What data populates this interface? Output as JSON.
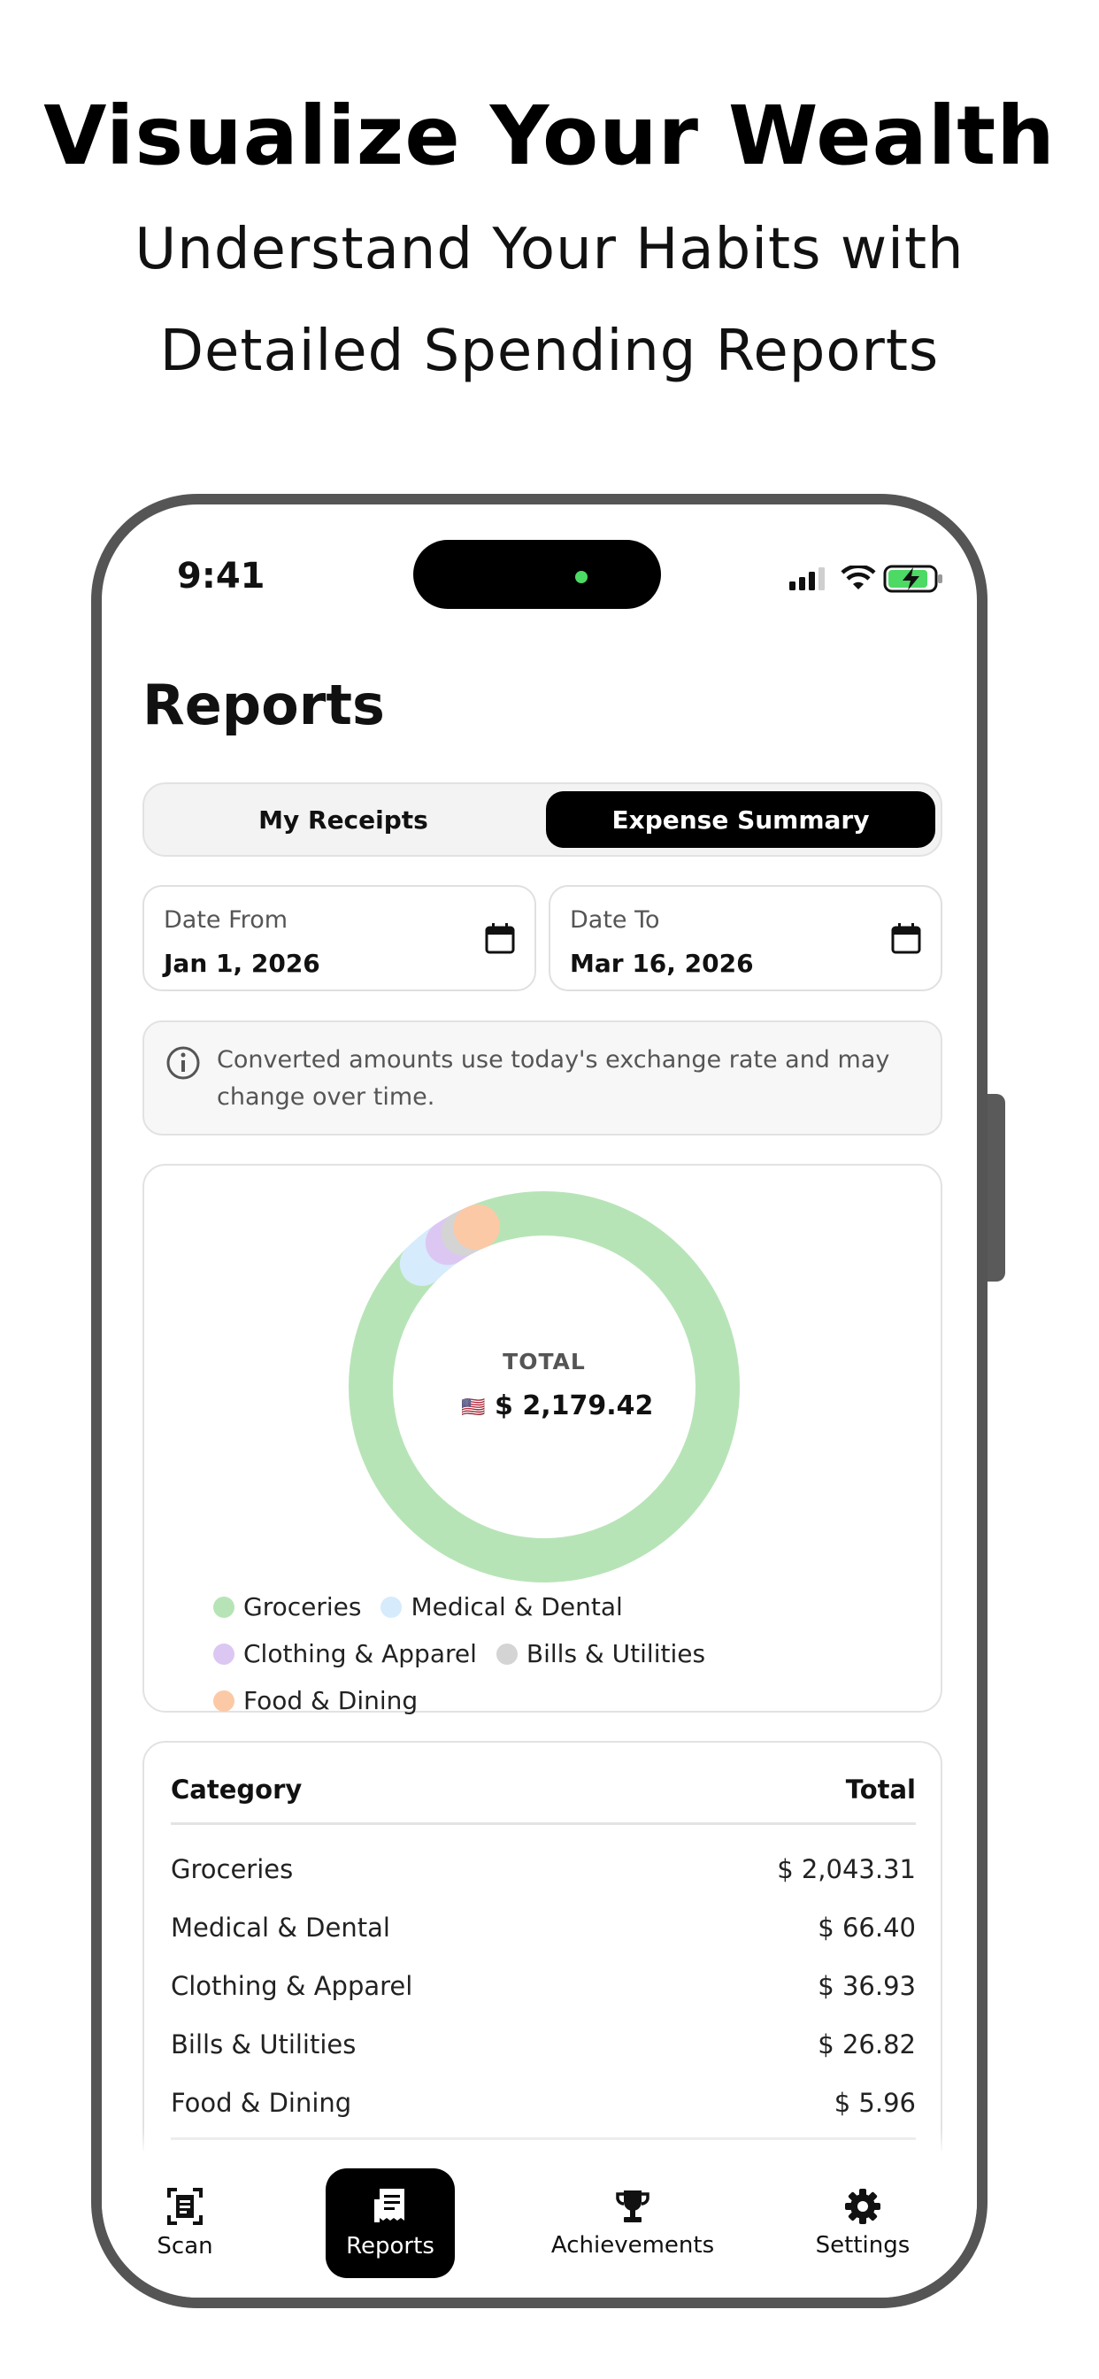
{
  "promo": {
    "headline": "Visualize Your Wealth",
    "subline_1": "Understand Your Habits with",
    "subline_2": "Detailed Spending Reports"
  },
  "status_bar": {
    "time": "9:41"
  },
  "page": {
    "title": "Reports"
  },
  "segment": {
    "left_label": "My Receipts",
    "right_label": "Expense Summary",
    "selected": "Expense Summary"
  },
  "date_from": {
    "label": "Date From",
    "value": "Jan 1, 2026"
  },
  "date_to": {
    "label": "Date To",
    "value": "Mar 16, 2026"
  },
  "info": {
    "text": "Converted amounts use today's exchange rate and may change over time."
  },
  "donut": {
    "center_label": "TOTAL",
    "flag": "🇺🇸",
    "total": "$ 2,179.42"
  },
  "chart_data": {
    "type": "pie",
    "categories": [
      "Groceries",
      "Medical & Dental",
      "Clothing & Apparel",
      "Bills & Utilities",
      "Food & Dining"
    ],
    "values": [
      2043.31,
      66.4,
      36.93,
      26.82,
      5.96
    ],
    "colors": [
      "#b7e4b7",
      "#d6ebfb",
      "#dcc7f3",
      "#d4d4d4",
      "#fcc9a6"
    ]
  },
  "legend": [
    {
      "label": "Groceries",
      "color": "#b7e4b7"
    },
    {
      "label": "Medical & Dental",
      "color": "#d6ebfb"
    },
    {
      "label": "Clothing & Apparel",
      "color": "#dcc7f3"
    },
    {
      "label": "Bills & Utilities",
      "color": "#d4d4d4"
    },
    {
      "label": "Food & Dining",
      "color": "#fcc9a6"
    }
  ],
  "table": {
    "col_category": "Category",
    "col_total": "Total",
    "rows": [
      {
        "category": "Groceries",
        "total": "$ 2,043.31"
      },
      {
        "category": "Medical & Dental",
        "total": "$ 66.40"
      },
      {
        "category": "Clothing & Apparel",
        "total": "$ 36.93"
      },
      {
        "category": "Bills & Utilities",
        "total": "$ 26.82"
      },
      {
        "category": "Food & Dining",
        "total": "$ 5.96"
      }
    ]
  },
  "tabbar": {
    "items": [
      {
        "label": "Scan",
        "icon": "scan-icon"
      },
      {
        "label": "Reports",
        "icon": "receipt-icon",
        "active": true
      },
      {
        "label": "Achievements",
        "icon": "trophy-icon"
      },
      {
        "label": "Settings",
        "icon": "gear-icon"
      }
    ]
  }
}
